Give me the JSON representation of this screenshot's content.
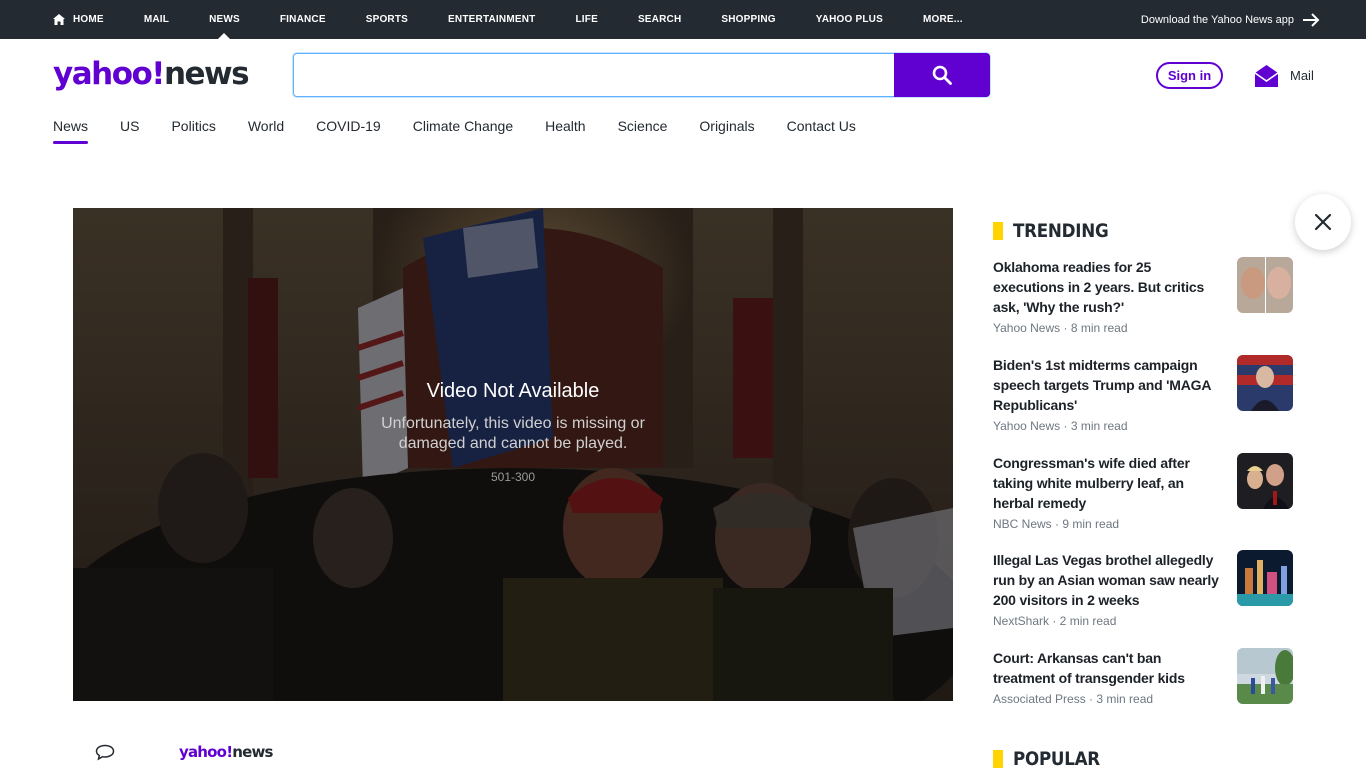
{
  "topnav": {
    "items": [
      "HOME",
      "MAIL",
      "NEWS",
      "FINANCE",
      "SPORTS",
      "ENTERTAINMENT",
      "LIFE",
      "SEARCH",
      "SHOPPING",
      "YAHOO PLUS",
      "MORE..."
    ],
    "download_app": "Download the Yahoo News app"
  },
  "header": {
    "logo_part1": "yahoo!",
    "logo_part2": "news",
    "search_placeholder": "",
    "signin_label": "Sign in",
    "mail_label": "Mail"
  },
  "subnav": {
    "items": [
      "News",
      "US",
      "Politics",
      "World",
      "COVID-19",
      "Climate Change",
      "Health",
      "Science",
      "Originals",
      "Contact Us"
    ]
  },
  "video": {
    "title": "Video Not Available",
    "message": "Unfortunately, this video is missing or damaged and cannot be played.",
    "code": "501-300"
  },
  "trending": {
    "heading": "TRENDING",
    "items": [
      {
        "title": "Oklahoma readies for 25 executions in 2 years. But critics ask, 'Why the rush?'",
        "meta": "Yahoo News · 8 min read"
      },
      {
        "title": "Biden's 1st midterms campaign speech targets Trump and 'MAGA Republicans'",
        "meta": "Yahoo News · 3 min read"
      },
      {
        "title": "Congressman's wife died after taking white mulberry leaf, an herbal remedy",
        "meta": "NBC News · 9 min read"
      },
      {
        "title": "Illegal Las Vegas brothel allegedly run by an Asian woman saw nearly 200 visitors in 2 weeks",
        "meta": "NextShark · 2 min read"
      },
      {
        "title": "Court: Arkansas can't ban treatment of transgender kids",
        "meta": "Associated Press · 3 min read"
      }
    ]
  },
  "popular": {
    "heading": "POPULAR"
  },
  "footer": {
    "logo_part1": "yahoo!",
    "logo_part2": "news"
  },
  "colors": {
    "brand_purple": "#6001d2",
    "topbar": "#232a31",
    "accent_yellow": "#ffd400"
  }
}
